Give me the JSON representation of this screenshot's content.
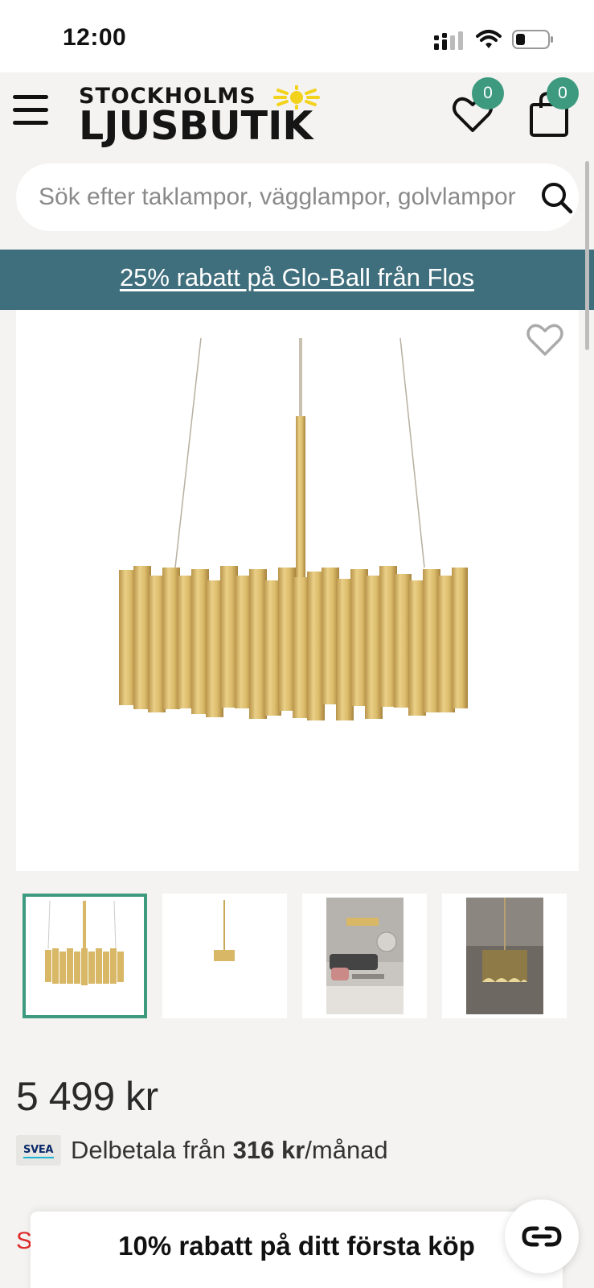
{
  "status_bar": {
    "time": "12:00"
  },
  "header": {
    "logo_top": "STOCKHOLMS",
    "logo_bottom": "LJUSBUTIK",
    "wishlist_count": "0",
    "cart_count": "0"
  },
  "search": {
    "placeholder": "Sök efter taklampor, vägglampor, golvlampor"
  },
  "promo": {
    "text": "25% rabatt på Glo-Ball från Flos"
  },
  "product": {
    "price": "5 499 kr",
    "installment": {
      "prefix": "Delbetala från ",
      "amount": "316 kr",
      "suffix": "/månad",
      "provider": "SVEA"
    },
    "thumbnails": [
      "chandelier-front",
      "chandelier-far",
      "living-room",
      "dark-room"
    ],
    "active_thumbnail": 0
  },
  "bottom": {
    "sale_peek": "S",
    "discount_popup": "10% rabatt på ditt första köp"
  },
  "colors": {
    "accent": "#3d9a7f",
    "promo_bg": "#3f6e7d",
    "gold": "#d8b766"
  }
}
